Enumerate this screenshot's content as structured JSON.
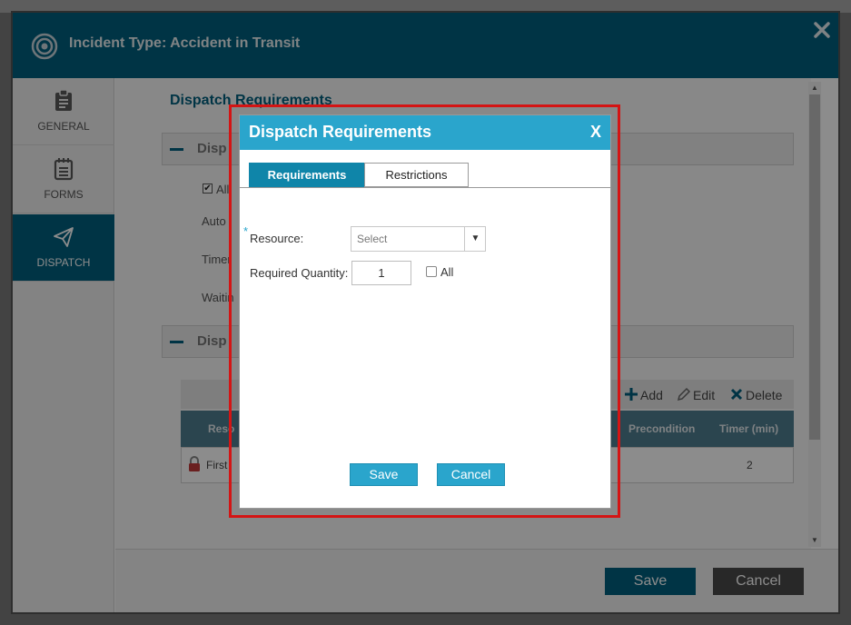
{
  "app": {
    "title": "Incident Type: Accident in Transit"
  },
  "nav": {
    "items": [
      {
        "label": "GENERAL",
        "icon": "clipboard-icon",
        "active": false
      },
      {
        "label": "FORMS",
        "icon": "notepad-icon",
        "active": false
      },
      {
        "label": "DISPATCH",
        "icon": "paper-plane-icon",
        "active": true
      }
    ]
  },
  "background": {
    "section_title": "Dispatch Requirements",
    "panel1_text": "Disp",
    "panel2_text": "Disp",
    "fragments": {
      "allow": "All",
      "auto": "Auto",
      "timer": "Timer",
      "waiting": "Waitin"
    },
    "toolbar": {
      "add": "Add",
      "edit": "Edit",
      "delete": "Delete"
    },
    "grid": {
      "headers": {
        "resource": "Reso",
        "precondition": "Precondition",
        "timer": "Timer (min)"
      },
      "row": {
        "name": "First",
        "timer": "2"
      }
    },
    "footer": {
      "save": "Save",
      "cancel": "Cancel"
    }
  },
  "dialog": {
    "title": "Dispatch Requirements",
    "close": "X",
    "tabs": [
      {
        "label": "Requirements",
        "active": true
      },
      {
        "label": "Restrictions",
        "active": false
      }
    ],
    "form": {
      "required_marker": "*",
      "resource_label": "Resource:",
      "resource_value": "Select",
      "quantity_label": "Required Quantity:",
      "quantity_value": "1",
      "all_label": "All",
      "all_checked": false
    },
    "buttons": {
      "save": "Save",
      "cancel": "Cancel"
    }
  },
  "colors": {
    "header": "#005f7e",
    "dialog_header": "#2aa5cc",
    "active_tab": "#0f85a9",
    "highlight_border": "#d41414"
  }
}
